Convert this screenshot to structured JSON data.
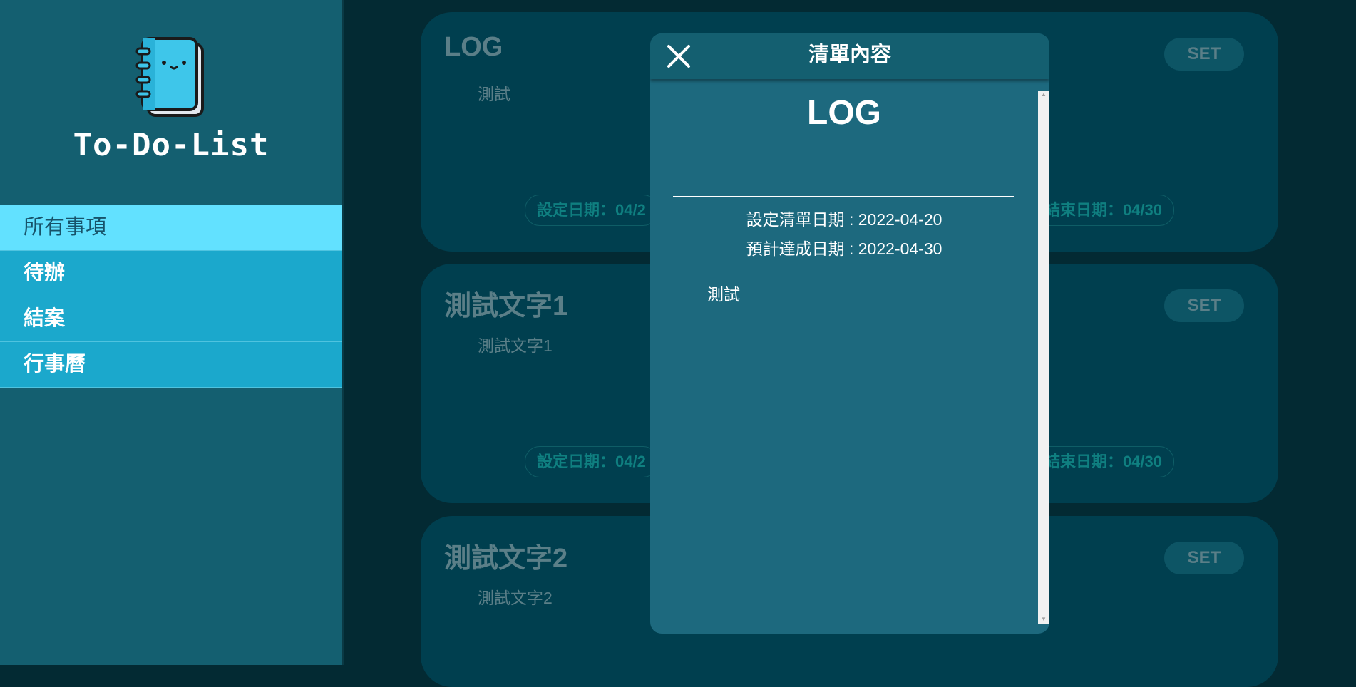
{
  "app": {
    "title": "To-Do-List",
    "logo_icon": "notebook-icon"
  },
  "sidebar": {
    "items": [
      {
        "label": "所有事項",
        "active": true
      },
      {
        "label": "待辦",
        "active": false
      },
      {
        "label": "結案",
        "active": false
      },
      {
        "label": "行事曆",
        "active": false
      }
    ]
  },
  "cards": [
    {
      "title": "LOG",
      "description": "測試",
      "set_label": "SET",
      "set_date": "設定日期：04/2",
      "end_date": "結束日期：04/30"
    },
    {
      "title": "測試文字1",
      "description": "測試文字1",
      "set_label": "SET",
      "set_date": "設定日期：04/2",
      "end_date": "結束日期：04/30"
    },
    {
      "title": "測試文字2",
      "description": "測試文字2",
      "set_label": "SET"
    }
  ],
  "modal": {
    "header_title": "清單內容",
    "close_icon": "close-icon",
    "item_title": "LOG",
    "set_date_line": "設定清單日期 : 2022-04-20",
    "due_date_line": "預計達成日期 : 2022-04-30",
    "content": "測試"
  },
  "colors": {
    "background": "#032a33",
    "sidebar": "#145f70",
    "nav": "#1ba8cc",
    "nav_active": "#62e1ff",
    "card": "#003f4f",
    "modal": "#1d697e"
  }
}
